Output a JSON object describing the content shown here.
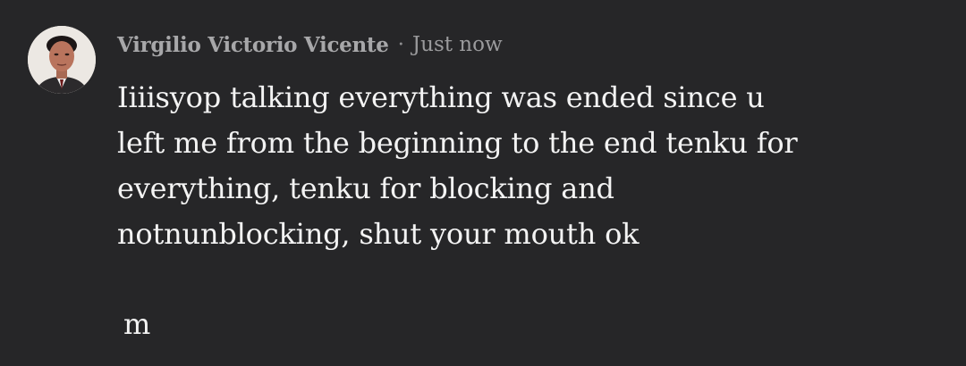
{
  "post": {
    "author": "Virgilio Victorio Vicente",
    "separator": "·",
    "timestamp": "Just now",
    "avatar_icon": "profile-photo",
    "message": "Iiiisyop talking everything was ended since u\nleft me from the beginning to the end tenku for\neverything, tenku for blocking and\nnotnunblocking, shut your mouth ok",
    "trailer": "m"
  },
  "colors": {
    "background": "#262628",
    "author": "#a7a7a9",
    "timestamp": "#9a9a9c",
    "message": "#f3f3f3"
  }
}
